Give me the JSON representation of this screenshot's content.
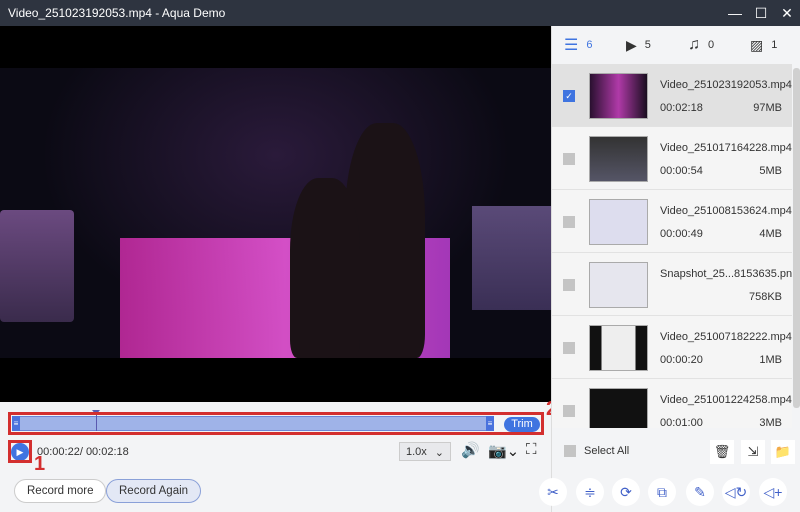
{
  "window": {
    "title": "Video_251023192053.mp4 - Aqua Demo",
    "minimize": "—",
    "maximize": "☐",
    "close": "✕"
  },
  "player": {
    "current_time": "00:00:22",
    "total_time": "/ 00:02:18",
    "speed": "1.0x",
    "trim_label": "Trim",
    "progress_fraction": 0.16
  },
  "annotations": {
    "one": "1",
    "two": "2"
  },
  "buttons": {
    "record_more": "Record more",
    "record_again": "Record Again"
  },
  "sidebar": {
    "tabs": [
      {
        "icon": "list-icon",
        "count": "6"
      },
      {
        "icon": "video-icon",
        "count": "5"
      },
      {
        "icon": "music-icon",
        "count": "0"
      },
      {
        "icon": "image-icon",
        "count": "1"
      }
    ],
    "items": [
      {
        "name": "Video_251023192053.mp4",
        "duration": "00:02:18",
        "size": "97MB",
        "checked": true
      },
      {
        "name": "Video_251017164228.mp4",
        "duration": "00:00:54",
        "size": "5MB",
        "checked": false
      },
      {
        "name": "Video_251008153624.mp4",
        "duration": "00:00:49",
        "size": "4MB",
        "checked": false
      },
      {
        "name": "Snapshot_25...8153635.png",
        "duration": "",
        "size": "758KB",
        "checked": false
      },
      {
        "name": "Video_251007182222.mp4",
        "duration": "00:00:20",
        "size": "1MB",
        "checked": false
      },
      {
        "name": "Video_251001224258.mp4",
        "duration": "00:01:00",
        "size": "3MB",
        "checked": false
      }
    ],
    "select_all": "Select All"
  },
  "accent": "#3f74e0"
}
